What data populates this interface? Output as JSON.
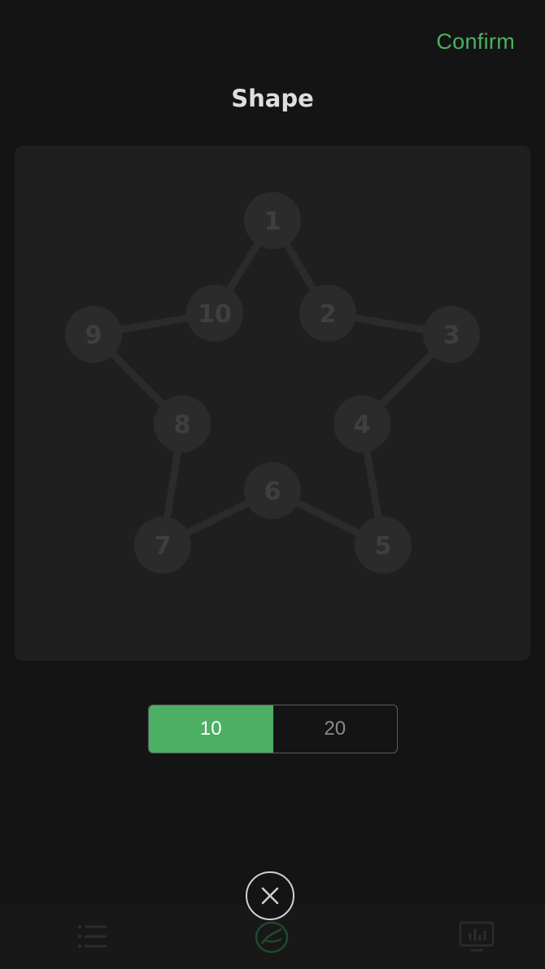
{
  "header": {
    "confirm_label": "Confirm",
    "title": "Shape"
  },
  "shape": {
    "name": "star",
    "nodes": [
      {
        "label": "1"
      },
      {
        "label": "2"
      },
      {
        "label": "3"
      },
      {
        "label": "4"
      },
      {
        "label": "5"
      },
      {
        "label": "6"
      },
      {
        "label": "7"
      },
      {
        "label": "8"
      },
      {
        "label": "9"
      },
      {
        "label": "10"
      }
    ]
  },
  "count_selector": {
    "options": [
      {
        "label": "10",
        "selected": true
      },
      {
        "label": "20",
        "selected": false
      }
    ]
  },
  "tabbar": {
    "icons": [
      "list-icon",
      "leaf-icon",
      "chart-icon"
    ]
  },
  "colors": {
    "accent": "#4bb063",
    "background": "#141414",
    "canvas": "#1f1f1f",
    "node": "#2b2b2b",
    "node_label": "#3f3f3f"
  }
}
